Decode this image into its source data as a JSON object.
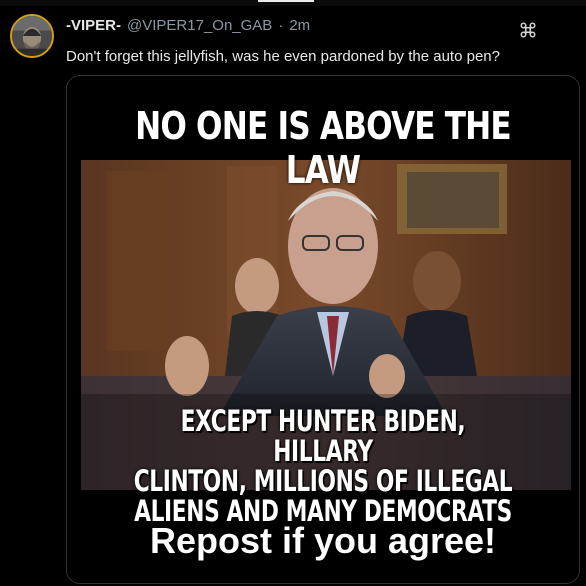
{
  "post": {
    "display_name": "-VIPER-",
    "handle": "@VIPER17_On_GAB",
    "separator": "·",
    "time": "2m",
    "text": "Don't forget this jellyfish, was he even pardoned by the auto pen?",
    "menu_icon": "command-icon"
  },
  "meme": {
    "top_text": "NO ONE IS ABOVE THE LAW",
    "mid_lines": [
      "EXCEPT HUNTER BIDEN, HILLARY",
      "CLINTON, MILLIONS OF ILLEGAL",
      "ALIENS AND MANY DEMOCRATS"
    ],
    "bottom_text": "Repost if you agree!"
  },
  "colors": {
    "background": "#000000",
    "text": "#e7e9ea",
    "muted": "#8b98a5",
    "avatar_ring": "#d4a017"
  }
}
